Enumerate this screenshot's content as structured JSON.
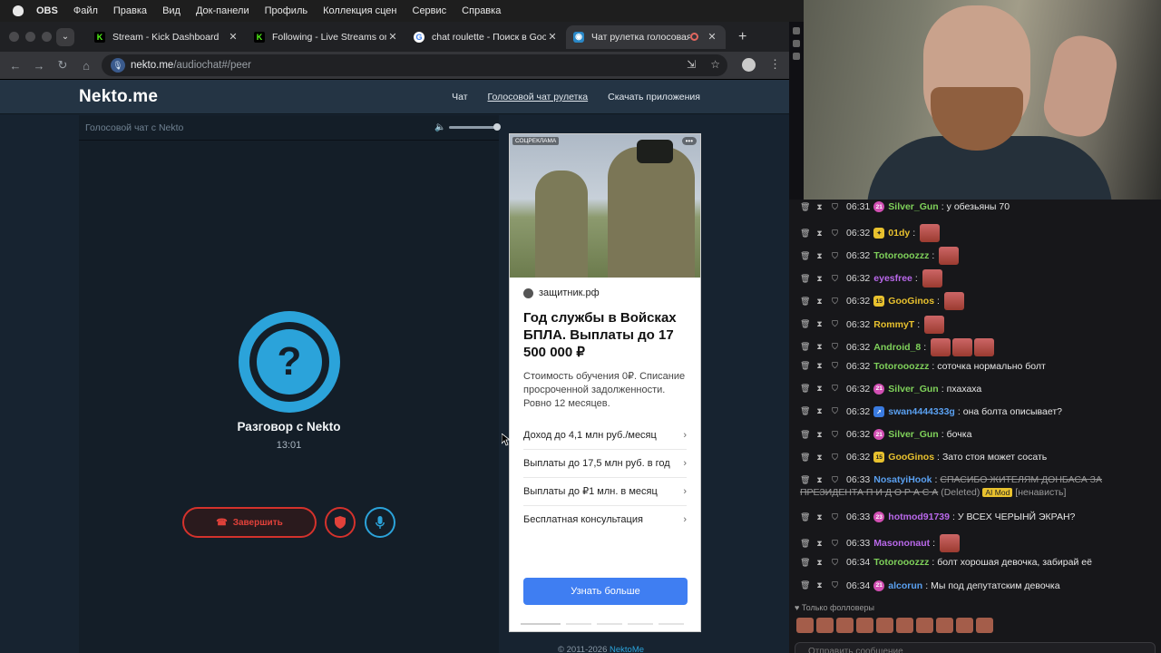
{
  "menubar": {
    "app": "OBS",
    "items": [
      "Файл",
      "Правка",
      "Вид",
      "Док-панели",
      "Профиль",
      "Коллекция сцен",
      "Сервис",
      "Справка"
    ]
  },
  "tabs": [
    {
      "title": "Stream - Kick Dashboard",
      "icon": "kick-icon"
    },
    {
      "title": "Following - Live Streams on K",
      "icon": "kick-icon"
    },
    {
      "title": "chat roulette - Поиск в Goog",
      "icon": "google-icon"
    },
    {
      "title": "Чат рулетка голосовая",
      "icon": "nekto-icon",
      "active": true
    }
  ],
  "address": {
    "host": "nekto.me",
    "path": "/audiochat#/peer"
  },
  "site": {
    "logo": "Nekto.me",
    "nav": [
      "Чат",
      "Голосовой чат рулетка",
      "Скачать приложения"
    ],
    "panel_title": "Голосовой чат с Nekto",
    "talk_name": "Разговор с Nekto",
    "timer": "13:01",
    "end_label": "Завершить",
    "copyright_prefix": "© 2011-2026",
    "copyright_link": "NektoMe"
  },
  "ad": {
    "tag": "СОЦРЕКЛАМА",
    "source": "защитник.рф",
    "headline": "Год службы в Войсках БПЛА. Выплаты до 17 500 000 ₽",
    "description": "Стоимость обучения 0₽. Списание просроченной задолженности. Ровно 12 месяцев.",
    "items": [
      "Доход до 4,1 млн руб./месяц",
      "Выплаты до 17,5 млн руб. в год",
      "Выплаты до ₽1 млн. в месяц",
      "Бесплатная консультация"
    ],
    "cta": "Узнать больше"
  },
  "chat": {
    "messages": [
      {
        "time": "06:31",
        "badge": "pink",
        "badge_text": "21",
        "nick": "Silver_Gun",
        "color": "#7fd15a",
        "text": "у обезьяны 70",
        "emotes": 0
      },
      {
        "time": "06:32",
        "badge": "gold",
        "badge_text": "✦",
        "nick": "01dy",
        "color": "#e8c12e",
        "text": "",
        "emotes": 1
      },
      {
        "time": "06:32",
        "badge": "",
        "badge_text": "",
        "nick": "Totorooozzz",
        "color": "#7fd15a",
        "text": "",
        "emotes": 1
      },
      {
        "time": "06:32",
        "badge": "",
        "badge_text": "",
        "nick": "eyesfree",
        "color": "#b968ea",
        "text": "",
        "emotes": 1
      },
      {
        "time": "06:32",
        "badge": "gold",
        "badge_text": "15",
        "nick": "GooGinos",
        "color": "#e8c12e",
        "text": "",
        "emotes": 1
      },
      {
        "time": "06:32",
        "badge": "",
        "badge_text": "",
        "nick": "RommyT",
        "color": "#e8c12e",
        "text": "",
        "emotes": 1
      },
      {
        "time": "06:32",
        "badge": "",
        "badge_text": "",
        "nick": "Android_8",
        "color": "#7fd15a",
        "text": "",
        "emotes": 3
      },
      {
        "time": "06:32",
        "badge": "",
        "badge_text": "",
        "nick": "Totorooozzz",
        "color": "#7fd15a",
        "text": "соточка нормально болт",
        "emotes": 0
      },
      {
        "time": "06:32",
        "badge": "pink",
        "badge_text": "21",
        "nick": "Silver_Gun",
        "color": "#7fd15a",
        "text": "пхахаха",
        "emotes": 0
      },
      {
        "time": "06:32",
        "badge": "blue",
        "badge_text": "➚",
        "nick": "swan4444333g",
        "color": "#5aa0f0",
        "text": "она болта описывает?",
        "emotes": 0
      },
      {
        "time": "06:32",
        "badge": "pink",
        "badge_text": "21",
        "nick": "Silver_Gun",
        "color": "#7fd15a",
        "text": "бочка",
        "emotes": 0
      },
      {
        "time": "06:32",
        "badge": "gold",
        "badge_text": "15",
        "nick": "GooGinos",
        "color": "#e8c12e",
        "text": "Зато стоя может сосать",
        "emotes": 0
      }
    ],
    "deleted": {
      "time": "06:33",
      "nick": "NosatyiHook",
      "text_line1": "СПАСИБО ЖИТЕЛЯМ ДОНБАСА ЗА",
      "text_line2": "ПРЕЗИДЕНТА П И Д О Р А С А",
      "deleted_label": "(Deleted)",
      "mod_label": "AI Mod",
      "reason": "[ненависть]"
    },
    "messages2": [
      {
        "time": "06:33",
        "badge": "pink",
        "badge_text": "23",
        "nick": "hotmod91739",
        "color": "#b968ea",
        "text": "У ВСЕХ ЧЕРЫНЙ ЭКРАН?",
        "emotes": 0
      },
      {
        "time": "06:33",
        "badge": "",
        "badge_text": "",
        "nick": "Masononaut",
        "color": "#b968ea",
        "text": "",
        "emotes": 1
      },
      {
        "time": "06:34",
        "badge": "",
        "badge_text": "",
        "nick": "Totorooozzz",
        "color": "#7fd15a",
        "text": "болт хорошая девочка, забирай её",
        "emotes": 0
      },
      {
        "time": "06:34",
        "badge": "pink",
        "badge_text": "21",
        "nick": "alcorun",
        "color": "#5aa0f0",
        "text": "Мы под депутатским девочка",
        "emotes": 0
      }
    ],
    "followers_only": "Только фолловеры",
    "input_placeholder": "Отправить сообщение"
  }
}
